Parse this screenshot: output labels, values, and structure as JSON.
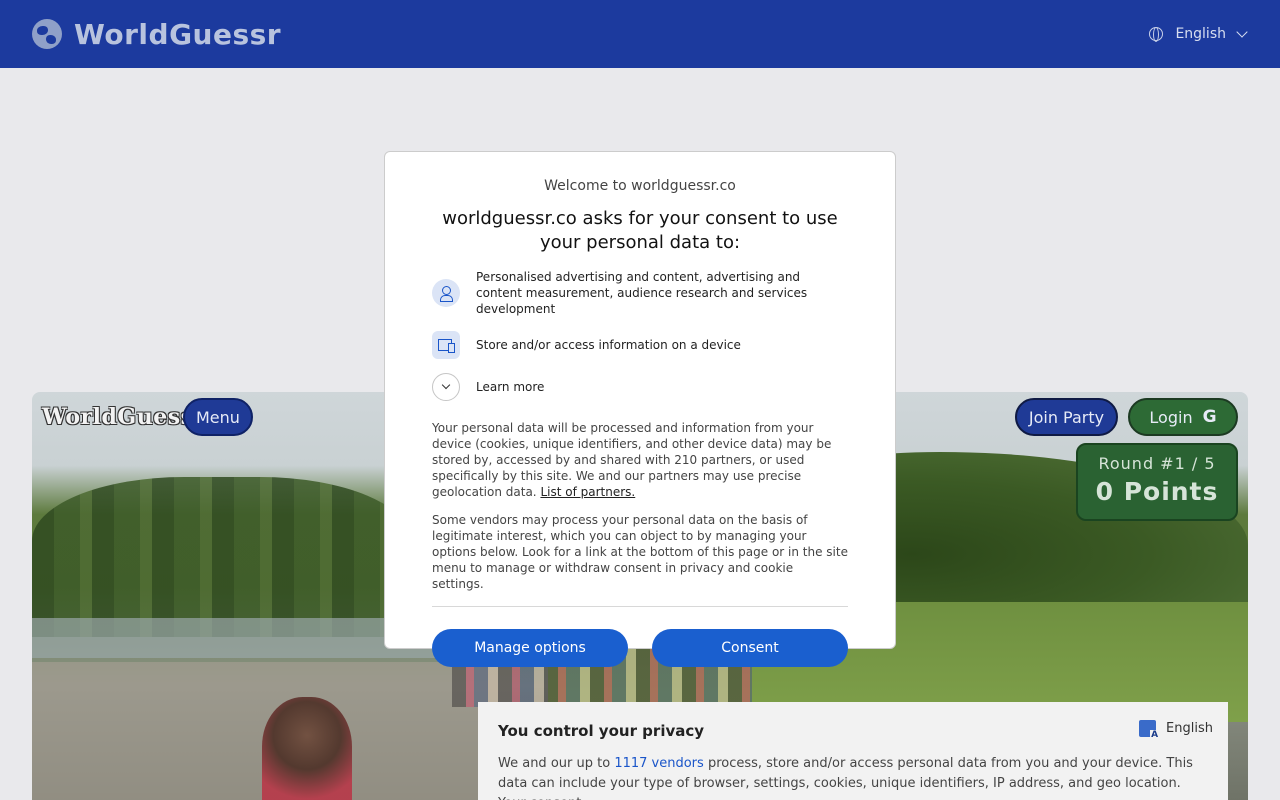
{
  "navbar": {
    "brand": "WorldGuessr",
    "language": "English"
  },
  "game": {
    "logo": "WorldGuessr",
    "menu_label": "Menu",
    "join_party_label": "Join Party",
    "login_label": "Login",
    "login_icon": "G",
    "round_text": "Round #1 / 5",
    "points_text": "0 Points"
  },
  "consent": {
    "welcome": "Welcome to worldguessr.co",
    "heading": "worldguessr.co asks for your consent to use your personal data to:",
    "purposes": [
      {
        "icon": "person-icon",
        "text": "Personalised advertising and content, advertising and content measurement, audience research and services development"
      },
      {
        "icon": "device-icon",
        "text": "Store and/or access information on a device"
      }
    ],
    "learn_more": "Learn more",
    "paragraph1": "Your personal data will be processed and information from your device (cookies, unique identifiers, and other device data) may be stored by, accessed by and shared with 210 partners, or used specifically by this site. We and our partners may use precise geolocation data.",
    "partners_link": "List of partners.",
    "paragraph2": "Some vendors may process your personal data on the basis of legitimate interest, which you can object to by managing your options below. Look for a link at the bottom of this page or in the site menu to manage or withdraw consent in privacy and cookie settings.",
    "manage_label": "Manage options",
    "consent_label": "Consent"
  },
  "privacy": {
    "title": "You control your privacy",
    "language": "English",
    "text_before": "We and our up to",
    "vendors_link": "1117 vendors",
    "text_after": "process, store and/or access personal data from you and your device. This data can include your type of browser, settings, cookies, unique identifiers, IP address, and geo location. Your consent"
  },
  "colors": {
    "navbar": "#1c3a9e",
    "consent_button": "#1a5fcf",
    "login_green": "#2d6a35"
  }
}
